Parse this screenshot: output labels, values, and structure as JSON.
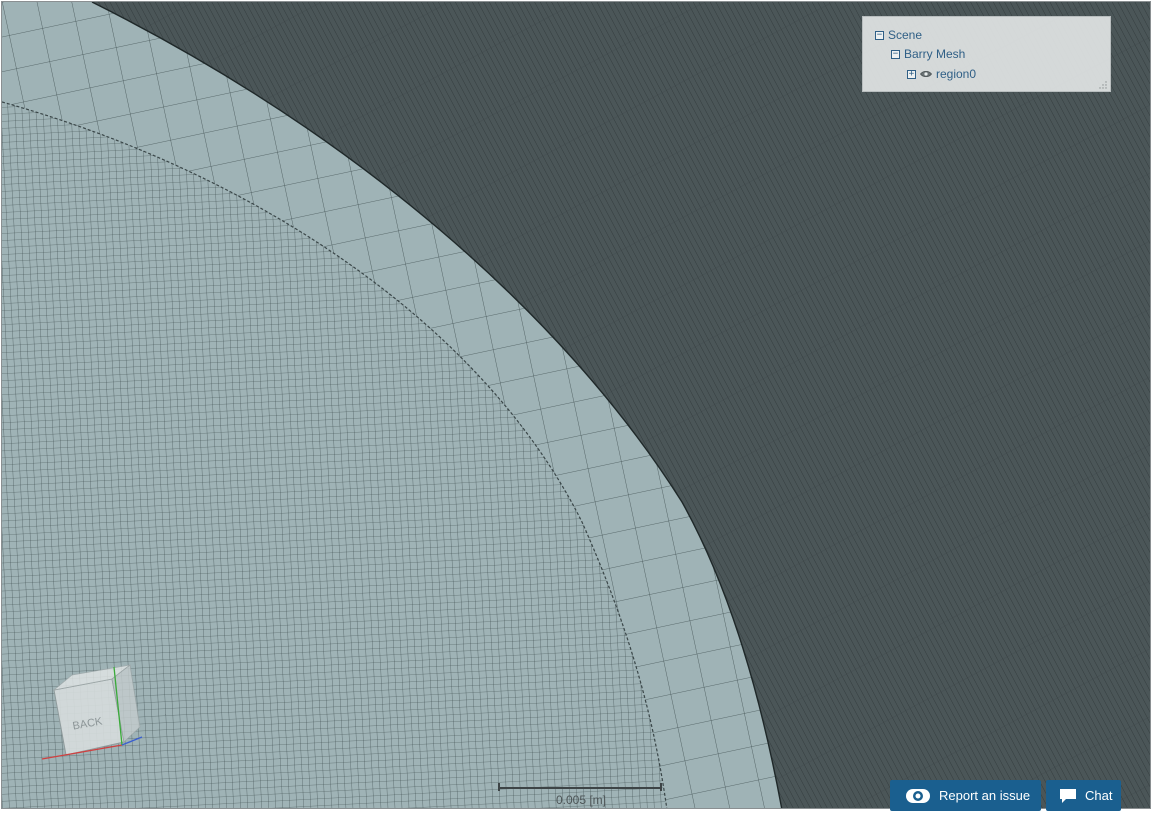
{
  "scene_tree": {
    "root_label": "Scene",
    "root_toggle": "−",
    "mesh_label": "Barry Mesh",
    "mesh_toggle": "−",
    "region_label": "region0",
    "region_toggle": "+"
  },
  "orientation_cube": {
    "face_label": "BACK"
  },
  "scale_bar": {
    "label": "0.005 [m]"
  },
  "buttons": {
    "report_label": "Report an issue",
    "chat_label": "Chat"
  },
  "colors": {
    "inner_mesh": "#9fb3b6",
    "outer_mesh": "#4b5658",
    "button": "#1a5f8f",
    "tree_text": "#2f5f86"
  },
  "icons": [
    "eye-icon",
    "camera-eye-icon",
    "chat-bubble-icon",
    "resize-grip-icon"
  ]
}
